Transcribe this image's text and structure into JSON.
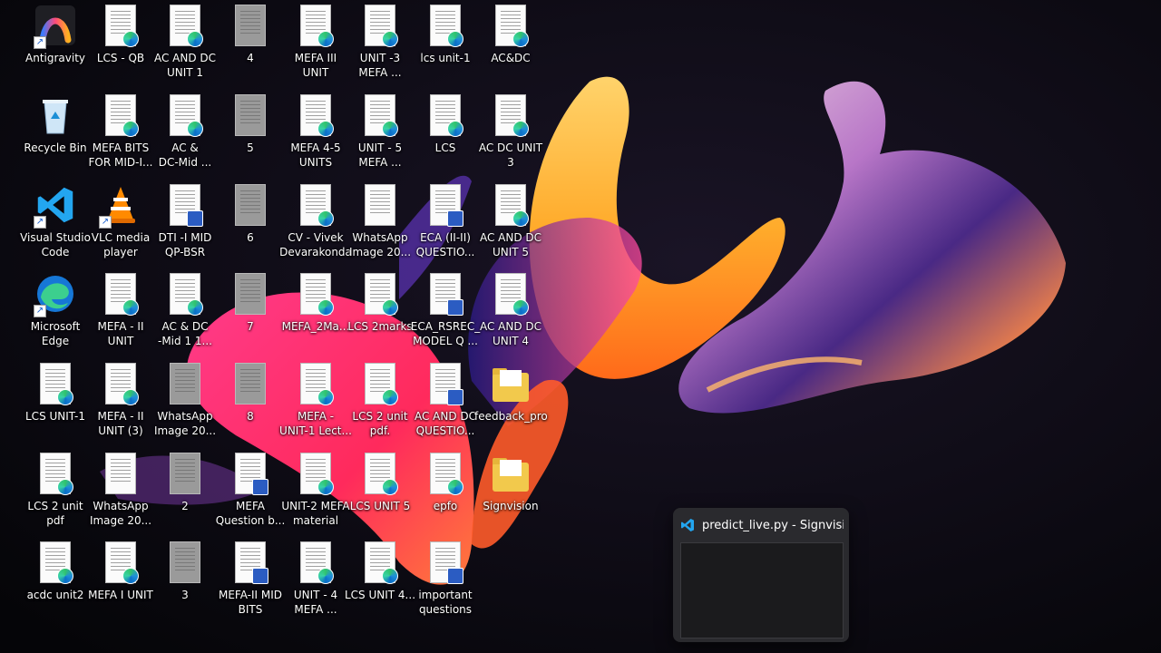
{
  "desktop": {
    "icons": [
      {
        "label": "Antigravity",
        "kind": "app-antigravity"
      },
      {
        "label": "Recycle Bin",
        "kind": "recycle"
      },
      {
        "label": "Visual Studio\nCode",
        "kind": "app-vscode"
      },
      {
        "label": "Microsoft\nEdge",
        "kind": "app-edge"
      },
      {
        "label": "LCS  UNIT-1",
        "kind": "pdf"
      },
      {
        "label": "LCS 2 unit\npdf",
        "kind": "pdf"
      },
      {
        "label": "acdc unit2",
        "kind": "pdf"
      },
      {
        "label": "LCS - QB",
        "kind": "pdf"
      },
      {
        "label": "MEFA BITS\nFOR MID-I...",
        "kind": "pdf"
      },
      {
        "label": "VLC media\nplayer",
        "kind": "app-vlc"
      },
      {
        "label": "MEFA - II\nUNIT",
        "kind": "pdf"
      },
      {
        "label": "MEFA - II\nUNIT (3)",
        "kind": "pdf"
      },
      {
        "label": "WhatsApp\nImage 20...",
        "kind": "image"
      },
      {
        "label": "MEFA I UNIT",
        "kind": "pdf"
      },
      {
        "label": "AC AND DC\nUNIT 1",
        "kind": "pdf"
      },
      {
        "label": "AC &\nDC-Mid ...",
        "kind": "pdf"
      },
      {
        "label": "DTI -I MID\nQP-BSR",
        "kind": "word"
      },
      {
        "label": "AC & DC\n-Mid 1 1...",
        "kind": "pdf"
      },
      {
        "label": "WhatsApp\nImage 20...",
        "kind": "image-grey"
      },
      {
        "label": "2",
        "kind": "image-grey"
      },
      {
        "label": "3",
        "kind": "image-grey"
      },
      {
        "label": "4",
        "kind": "image-grey"
      },
      {
        "label": "5",
        "kind": "image-grey"
      },
      {
        "label": "6",
        "kind": "image-grey"
      },
      {
        "label": "7",
        "kind": "image-grey"
      },
      {
        "label": "8",
        "kind": "image-grey"
      },
      {
        "label": "MEFA\nQuestion b...",
        "kind": "word"
      },
      {
        "label": "MEFA-II MID\nBITS",
        "kind": "word"
      },
      {
        "label": "MEFA III\nUNIT",
        "kind": "pdf"
      },
      {
        "label": "MEFA 4-5\nUNITS",
        "kind": "pdf"
      },
      {
        "label": "CV - Vivek\nDevarakonda",
        "kind": "pdf"
      },
      {
        "label": "MEFA_2Ma...",
        "kind": "pdf"
      },
      {
        "label": "MEFA -\nUNIT-1 Lect...",
        "kind": "pdf"
      },
      {
        "label": "UNIT-2 MEFA\nmaterial",
        "kind": "pdf"
      },
      {
        "label": "UNIT - 4\nMEFA ...",
        "kind": "pdf"
      },
      {
        "label": "UNIT -3\nMEFA ...",
        "kind": "pdf"
      },
      {
        "label": "UNIT - 5\nMEFA ...",
        "kind": "pdf"
      },
      {
        "label": "WhatsApp\nImage 20...",
        "kind": "image"
      },
      {
        "label": "LCS 2marks",
        "kind": "pdf"
      },
      {
        "label": "LCS 2 unit\npdf.",
        "kind": "pdf"
      },
      {
        "label": "LCS UNIT 5",
        "kind": "pdf"
      },
      {
        "label": "LCS UNIT 4...",
        "kind": "pdf"
      },
      {
        "label": "lcs unit-1",
        "kind": "pdf"
      },
      {
        "label": "LCS",
        "kind": "pdf"
      },
      {
        "label": "ECA (II-II)\nQUESTIO...",
        "kind": "word"
      },
      {
        "label": "ECA_RSREC_\nMODEL Q ...",
        "kind": "word"
      },
      {
        "label": "AC AND DC\nQUESTIO...",
        "kind": "word"
      },
      {
        "label": "epfo",
        "kind": "pdf"
      },
      {
        "label": "important\nquestions",
        "kind": "word"
      },
      {
        "label": "AC&DC",
        "kind": "pdf"
      },
      {
        "label": "AC DC UNIT\n3",
        "kind": "pdf"
      },
      {
        "label": "AC AND DC\nUNIT 5",
        "kind": "pdf"
      },
      {
        "label": "AC AND DC\nUNIT 4",
        "kind": "pdf"
      },
      {
        "label": "feedback_pro",
        "kind": "folder"
      },
      {
        "label": "Signvision",
        "kind": "folder"
      }
    ]
  },
  "taskbar_preview": {
    "title": "predict_live.py - Signvisi...",
    "icon": "vscode-icon"
  }
}
